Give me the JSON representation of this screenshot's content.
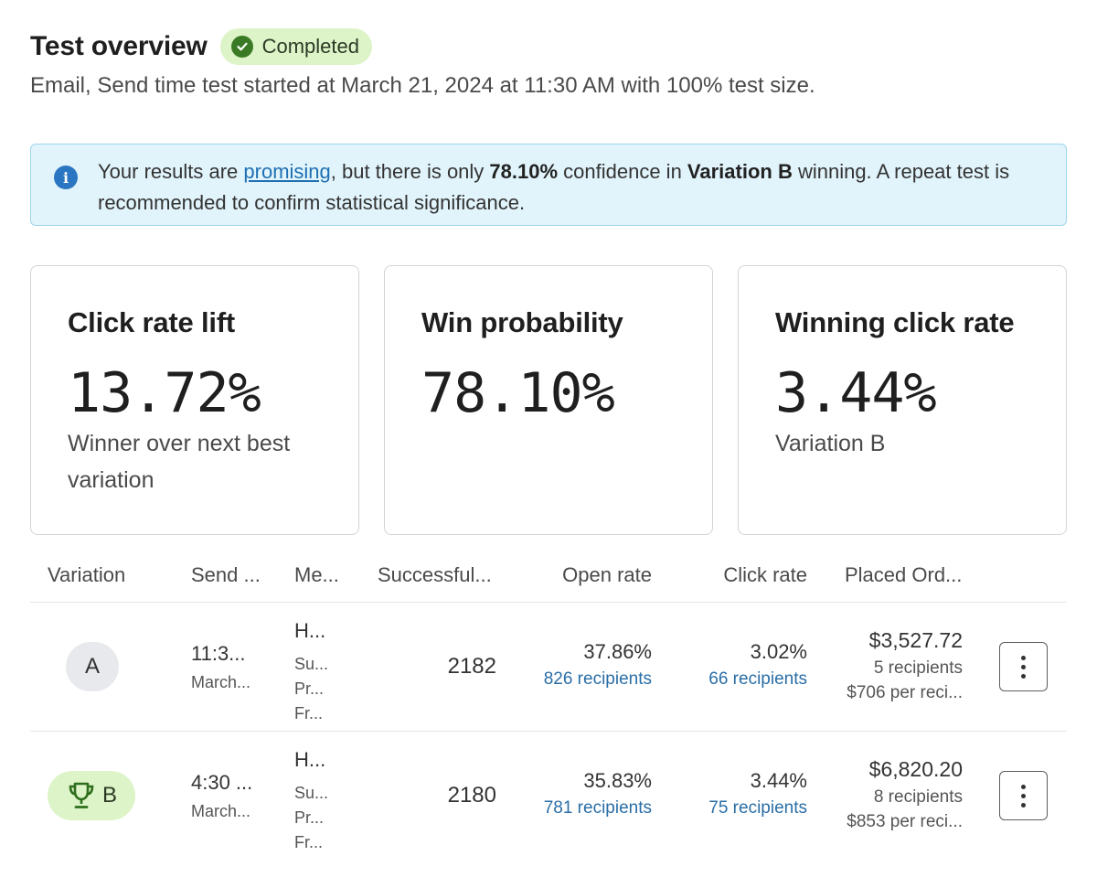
{
  "header": {
    "title": "Test overview",
    "status": "Completed",
    "subtitle": "Email, Send time test started at March 21, 2024 at 11:30 AM with 100% test size."
  },
  "banner": {
    "text_1": "Your results are ",
    "link": "promising",
    "text_2": ", but there is only ",
    "confidence": "78.10%",
    "text_3": " confidence in ",
    "variation": "Variation B",
    "text_4": " winning. A repeat test is recommended to confirm statistical significance."
  },
  "cards": [
    {
      "title": "Click rate lift",
      "value": "13.72%",
      "desc": "Winner over next best variation"
    },
    {
      "title": "Win probability",
      "value": "78.10%",
      "desc": ""
    },
    {
      "title": "Winning click rate",
      "value": "3.44%",
      "desc": "Variation B"
    }
  ],
  "table": {
    "headers": [
      "Variation",
      "Send ...",
      "Me...",
      "Successful...",
      "Open rate",
      "Click rate",
      "Placed Ord..."
    ],
    "rows": [
      {
        "variation": "A",
        "send_time": "11:3...",
        "send_date": "March...",
        "message": "H...",
        "message_lines": [
          "Su...",
          "Pr...",
          "Fr..."
        ],
        "successful": "2182",
        "open_rate": "37.86%",
        "open_recipients": "826 recipients",
        "click_rate": "3.02%",
        "click_recipients": "66 recipients",
        "orders_value": "$3,527.72",
        "orders_recipients": "5 recipients",
        "orders_per": "$706 per reci..."
      },
      {
        "variation": "B",
        "send_time": "4:30 ...",
        "send_date": "March...",
        "message": "H...",
        "message_lines": [
          "Su...",
          "Pr...",
          "Fr..."
        ],
        "successful": "2180",
        "open_rate": "35.83%",
        "open_recipients": "781 recipients",
        "click_rate": "3.44%",
        "click_recipients": "75 recipients",
        "orders_value": "$6,820.20",
        "orders_recipients": "8 recipients",
        "orders_per": "$853 per reci..."
      }
    ]
  },
  "icons": {
    "status": "check-circle-icon",
    "banner": "info-icon",
    "winner": "trophy-icon",
    "row_menu": "kebab-menu-icon"
  },
  "colors": {
    "success_bg": "#ddf3c8",
    "success_icon": "#3b7a24",
    "info_bg": "#e1f4fb",
    "info_border": "#9fd6ec",
    "link": "#2a6ea6"
  }
}
